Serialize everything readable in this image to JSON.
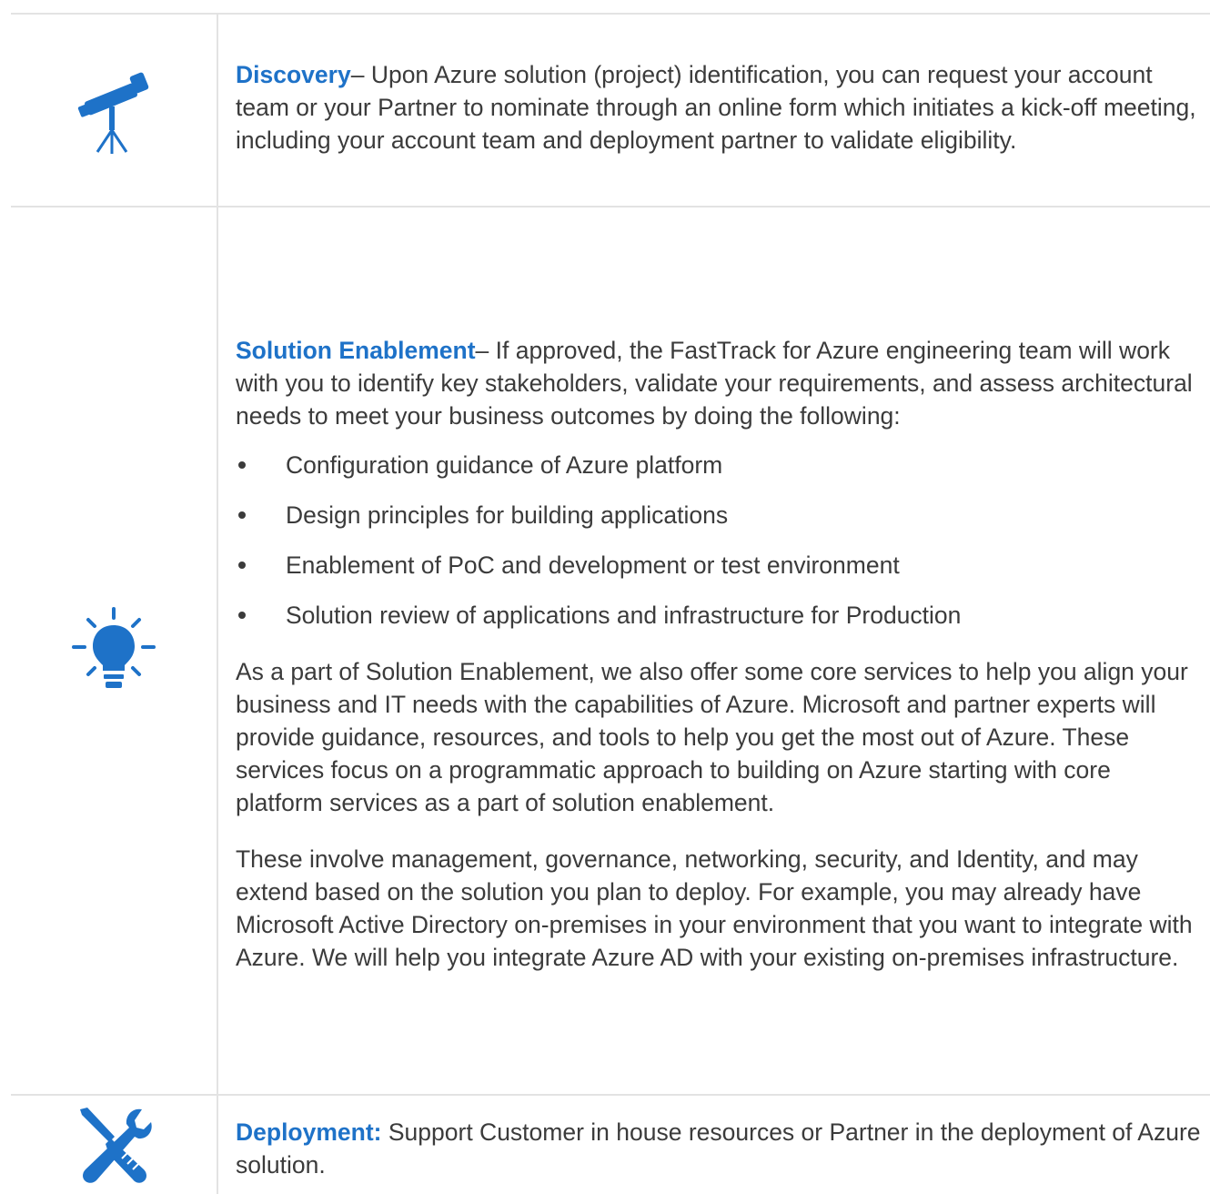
{
  "phases": [
    {
      "icon": "telescope-icon",
      "title": "Discovery",
      "separator": "– ",
      "text": "Upon Azure solution (project) identification, you can request your account team or your Partner to nominate through an online form which initiates a kick-off meeting, including your account team and deployment partner to validate eligibility."
    },
    {
      "icon": "lightbulb-icon",
      "title": "Solution Enablement",
      "separator": "– ",
      "text": "If approved, the FastTrack for Azure engineering team will work with you to identify key stakeholders, validate your requirements, and assess architectural needs to meet your business outcomes by doing the following:",
      "bullets": [
        "Configuration guidance of Azure platform",
        "Design principles for building applications",
        "Enablement of PoC and development or test environment",
        "Solution review of applications and infrastructure for Production"
      ],
      "paragraphs": [
        "As a part of Solution Enablement, we also offer some core services to help you align your business and IT needs with the capabilities of Azure. Microsoft and partner experts will provide guidance, resources, and tools to help you get the most out of Azure. These services focus on a programmatic approach to building on Azure starting with core platform services as a part of solution enablement.",
        "These involve management, governance, networking, security, and Identity, and may extend based on the solution you plan to deploy. For example, you may already have Microsoft Active Directory on-premises in your environment that you want to integrate with Azure. We will help you integrate Azure AD with your existing on-premises infrastructure."
      ]
    },
    {
      "icon": "wrench-screwdriver-icon",
      "title": "Deployment:",
      "separator": " ",
      "text": "Support Customer in house resources or Partner in the deployment of Azure solution."
    }
  ],
  "colors": {
    "accent": "#1e72c8",
    "body_text": "#3b3b3b",
    "border": "#e3e3e3"
  }
}
